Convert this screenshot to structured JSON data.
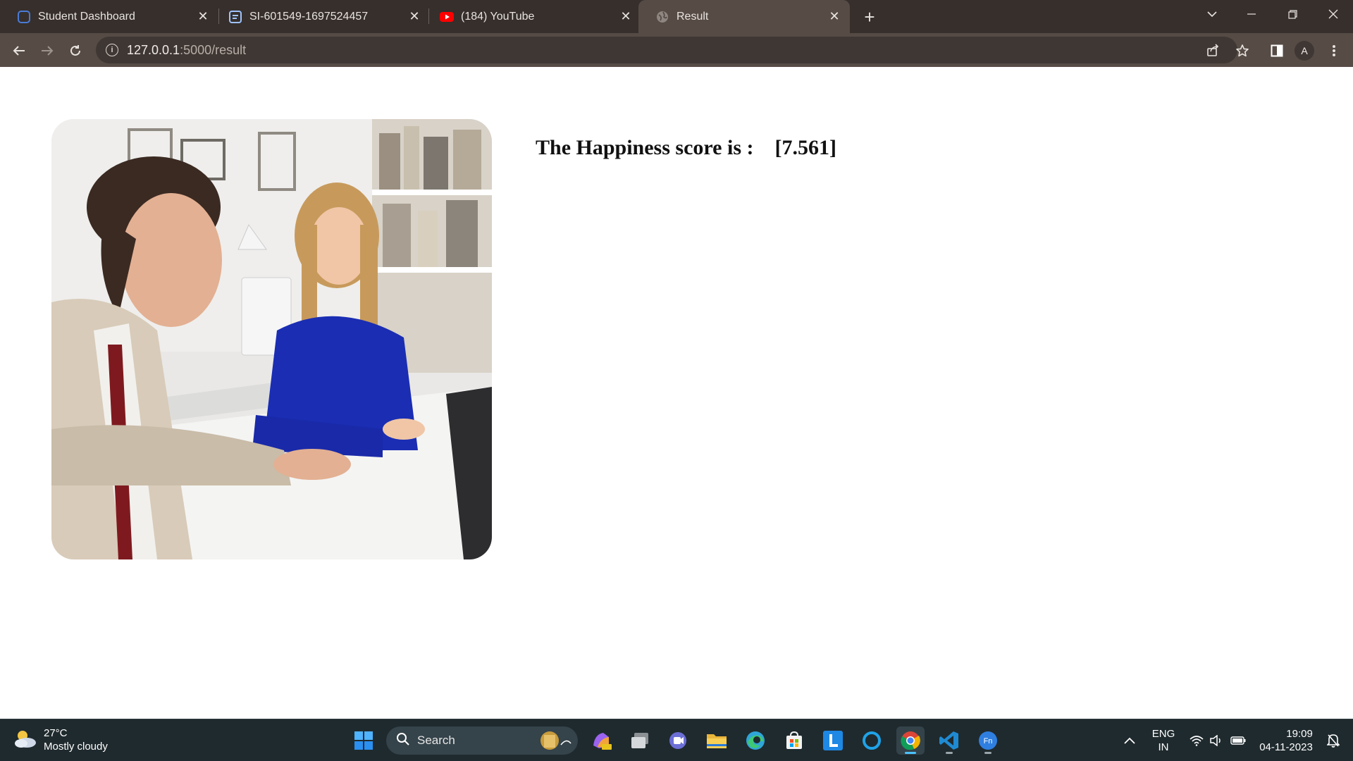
{
  "browser": {
    "tabs": [
      {
        "title": "Student Dashboard",
        "icon": "dashboard-favicon",
        "active": false
      },
      {
        "title": "SI-601549-1697524457",
        "icon": "document-favicon",
        "active": false
      },
      {
        "title": "(184) YouTube",
        "icon": "youtube-favicon",
        "active": false
      },
      {
        "title": "Result",
        "icon": "globe-favicon",
        "active": true
      }
    ],
    "url_host": "127.0.0.1",
    "url_path": ":5000/result",
    "profile_initial": "A"
  },
  "page": {
    "result_label": "The Happiness score is :",
    "result_value": "[7.561]",
    "image": "photo-two-people-office-meeting"
  },
  "taskbar": {
    "weather_temp": "27°C",
    "weather_desc": "Mostly cloudy",
    "search_placeholder": "Search",
    "lang_top": "ENG",
    "lang_bottom": "IN",
    "time": "19:09",
    "date": "04-11-2023"
  },
  "colors": {
    "tabstrip": "#362f2c",
    "toolbar": "#564b45",
    "taskbar": "#1f2a2e",
    "accent": "#4cc2ff"
  }
}
